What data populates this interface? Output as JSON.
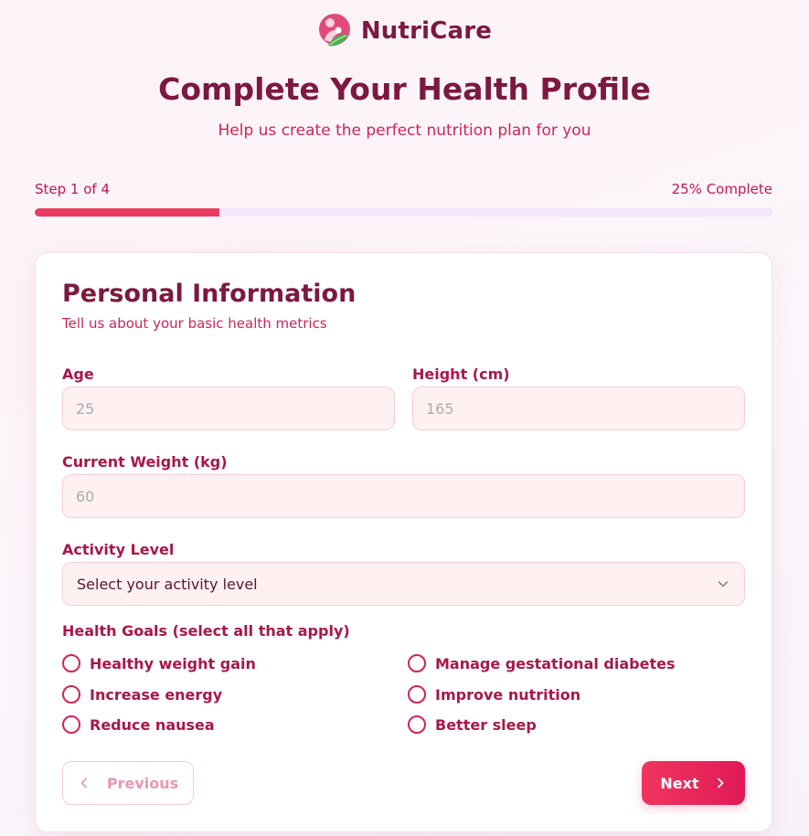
{
  "brand": {
    "name": "NutriCare",
    "logo_icon": "mother-baby-leaf-icon"
  },
  "header": {
    "title": "Complete Your Health Profile",
    "subtitle": "Help us create the perfect nutrition plan for you"
  },
  "progress": {
    "step_label": "Step 1 of 4",
    "complete_label": "25% Complete",
    "fraction": 0.25
  },
  "form": {
    "section_title": "Personal Information",
    "section_subtitle": "Tell us about your basic health metrics",
    "age": {
      "label": "Age",
      "placeholder": "25"
    },
    "height": {
      "label": "Height (cm)",
      "placeholder": "165"
    },
    "weight": {
      "label": "Current Weight (kg)",
      "placeholder": "60"
    },
    "activity": {
      "label": "Activity Level",
      "value": "Select your activity level"
    },
    "goals": {
      "label": "Health Goals (select all that apply)",
      "options": [
        "Healthy weight gain",
        "Manage gestational diabetes",
        "Increase energy",
        "Improve nutrition",
        "Reduce nausea",
        "Better sleep"
      ]
    }
  },
  "buttons": {
    "previous": "Previous",
    "next": "Next"
  },
  "colors": {
    "brand": "#7d1840",
    "accent": "#ec3b63",
    "accent_text": "#d0245a",
    "input_bg": "#fff0f1",
    "track": "#f1e6fb"
  }
}
